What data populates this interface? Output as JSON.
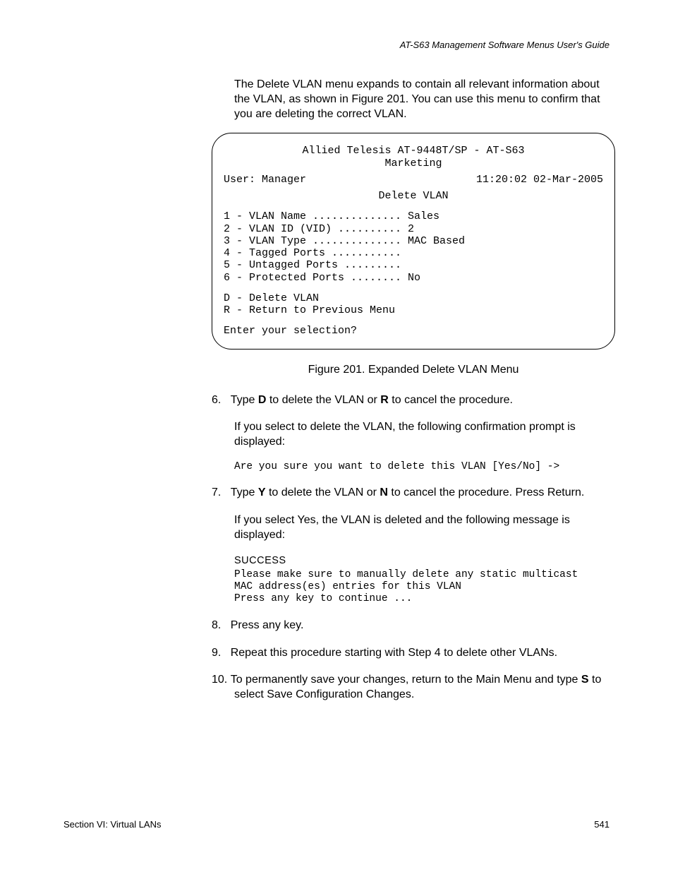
{
  "header": {
    "guide_title": "AT-S63 Management Software Menus User's Guide"
  },
  "intro": {
    "text": "The Delete VLAN menu expands to contain all relevant information about the VLAN, as shown in Figure 201. You can use this menu to confirm that you are deleting the correct VLAN."
  },
  "terminal": {
    "title_line1": "Allied Telesis AT-9448T/SP - AT-S63",
    "title_line2": "Marketing",
    "user_label": "User: Manager",
    "timestamp": "11:20:02 02-Mar-2005",
    "menu_title": "Delete VLAN",
    "items": [
      "1 - VLAN Name .............. Sales",
      "2 - VLAN ID (VID) .......... 2",
      "3 - VLAN Type .............. MAC Based",
      "4 - Tagged Ports ...........",
      "5 - Untagged Ports .........",
      "6 - Protected Ports ........ No"
    ],
    "actions": [
      "D - Delete VLAN",
      "R - Return to Previous Menu"
    ],
    "prompt": "Enter your selection?"
  },
  "figure_caption": "Figure 201. Expanded Delete VLAN Menu",
  "steps": {
    "s6": {
      "num": "6.",
      "pre": "Type ",
      "key1": "D",
      "mid1": " to delete the VLAN or ",
      "key2": "R",
      "post": " to cancel the procedure.",
      "sub1": "If you select to delete the VLAN, the following confirmation prompt is displayed:",
      "code": "Are you sure you want to delete this VLAN [Yes/No] ->"
    },
    "s7": {
      "num": "7.",
      "pre": "Type ",
      "key1": "Y",
      "mid1": " to delete the VLAN or ",
      "key2": "N",
      "post": " to cancel the procedure. Press Return.",
      "sub1": "If you select Yes, the VLAN is deleted and the following message is displayed:",
      "success": "SUCCESS",
      "code": "Please make sure to manually delete any static multicast\nMAC address(es) entries for this VLAN\nPress any key to continue ..."
    },
    "s8": {
      "num": "8.",
      "text": "Press any key."
    },
    "s9": {
      "num": "9.",
      "text": "Repeat this procedure starting with Step 4 to delete other VLANs."
    },
    "s10": {
      "num": "10.",
      "pre": "To permanently save your changes, return to the Main Menu and type ",
      "key1": "S",
      "post": " to select Save Configuration Changes."
    }
  },
  "footer": {
    "section": "Section VI: Virtual LANs",
    "page": "541"
  }
}
